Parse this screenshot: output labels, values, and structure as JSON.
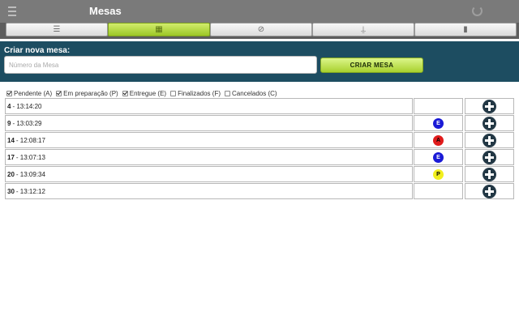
{
  "header": {
    "title": "Mesas",
    "menu_icon": "hamburger-menu-icon",
    "refresh_icon": "refresh-icon"
  },
  "tabs": [
    {
      "icon": "list-icon",
      "glyph": "☰",
      "active": false
    },
    {
      "icon": "table-icon",
      "glyph": "▦",
      "active": true
    },
    {
      "icon": "coin-icon",
      "glyph": "⊘",
      "active": false
    },
    {
      "icon": "bottle-glass-icon",
      "glyph": "⍊",
      "active": false
    },
    {
      "icon": "trash-icon",
      "glyph": "▮",
      "active": false
    }
  ],
  "create": {
    "label": "Criar nova mesa:",
    "input_placeholder": "Número da Mesa",
    "input_value": "",
    "button_label": "CRIAR MESA"
  },
  "filters": [
    {
      "label": "Pendente (A)",
      "checked": true
    },
    {
      "label": "Em preparação (P)",
      "checked": true
    },
    {
      "label": "Entregue (E)",
      "checked": true
    },
    {
      "label": "Finalizados (F)",
      "checked": false
    },
    {
      "label": "Cancelados (C)",
      "checked": false
    }
  ],
  "tables": [
    {
      "number": "4",
      "time": " - 13:14:20",
      "status": ""
    },
    {
      "number": "9",
      "time": " - 13:03:29",
      "status": "E"
    },
    {
      "number": "14",
      "time": " - 12:08:17",
      "status": "A"
    },
    {
      "number": "17",
      "time": " - 13:07:13",
      "status": "E"
    },
    {
      "number": "20",
      "time": " - 13:09:34",
      "status": "P"
    },
    {
      "number": "30",
      "time": " - 13:12:12",
      "status": ""
    }
  ],
  "status_colors": {
    "E": "#1a1ad6",
    "A": "#e01b1b",
    "P": "#f2ef1e"
  },
  "accent_color": "#a8d12e",
  "panel_color": "#1d4d61"
}
